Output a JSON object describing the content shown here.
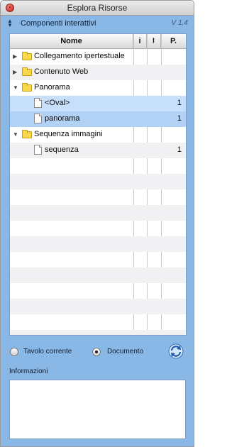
{
  "window": {
    "title": "Esplora Risorse"
  },
  "header": {
    "section_label": "Componenti interattivi",
    "version": "V 1.4"
  },
  "columns": [
    "Nome",
    "i",
    "!",
    "P."
  ],
  "tree": [
    {
      "label": "Collegamento ipertestuale",
      "type": "folder",
      "expanded": false,
      "count": ""
    },
    {
      "label": "Contenuto Web",
      "type": "folder",
      "expanded": false,
      "count": ""
    },
    {
      "label": "Panorama",
      "type": "folder",
      "expanded": true,
      "count": ""
    },
    {
      "label": "<Oval>",
      "type": "document",
      "count": "1",
      "selected": true
    },
    {
      "label": "panorama",
      "type": "document",
      "count": "1",
      "selected": true
    },
    {
      "label": "Sequenza immagini",
      "type": "folder",
      "expanded": true,
      "count": ""
    },
    {
      "label": "sequenza",
      "type": "document",
      "count": "1"
    }
  ],
  "footer": {
    "radio_current": "Tavolo corrente",
    "radio_document": "Documento",
    "selected_radio": "Documento",
    "info_label": "Informazioni"
  },
  "colors": {
    "accent": "#8ab8e6",
    "selection": "#b1d1f5",
    "folder": "#f9d94a"
  }
}
